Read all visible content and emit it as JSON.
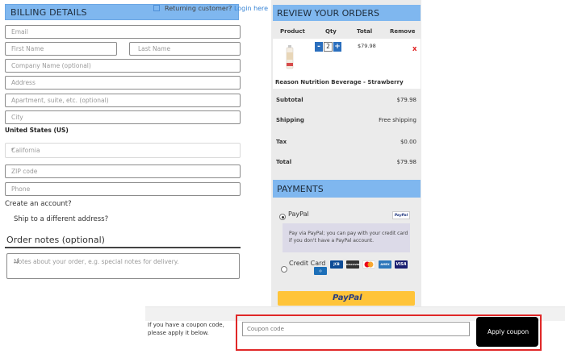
{
  "billing": {
    "header": "BILLING DETAILS",
    "returning_text": "Returning customer?",
    "login_link": "Login here",
    "fields": {
      "email": "Email",
      "first_name": "First Name",
      "last_name": "Last Name",
      "company": "Company Name (optional)",
      "address": "Address",
      "apartment": "Apartment, suite, etc. (optional)",
      "city": "City",
      "country": "United States (US)",
      "state": "California",
      "zip": "ZIP code",
      "phone": "Phone"
    },
    "create_account": "Create an account?",
    "ship_different": "Ship to a different address?",
    "order_notes_title": "Order notes (optional)",
    "order_notes_placeholder": "Notes about your order, e.g. special notes for delivery."
  },
  "review": {
    "header": "REVIEW YOUR ORDERS",
    "columns": [
      "Product",
      "Qty",
      "Total",
      "Remove"
    ],
    "item": {
      "name": "Reason Nutrition Beverage - Strawberry",
      "qty": "2",
      "total": "$79.98",
      "remove": "x",
      "minus": "-",
      "plus": "+"
    },
    "summary": {
      "subtotal_label": "Subtotal",
      "subtotal_value": "$79.98",
      "shipping_label": "Shipping",
      "shipping_value": "Free shipping",
      "tax_label": "Tax",
      "tax_value": "$0.00",
      "total_label": "Total",
      "total_value": "$79.98"
    }
  },
  "payments": {
    "header": "PAYMENTS",
    "paypal_label": "PayPal",
    "paypal_badge": "PayPal",
    "paypal_desc": "Pay via PayPal; you can pay with your credit card if you don't have a PayPal account.",
    "credit_label": "Credit Card",
    "cards": [
      "JCB",
      "DISCOVER",
      "MC",
      "AMEX",
      "VISA"
    ],
    "paypal_button": "PayPal"
  },
  "coupon": {
    "text": "If you have a coupon code, please apply it below.",
    "placeholder": "Coupon code",
    "apply": "Apply coupon"
  },
  "colors": {
    "section_header": "#7fb7ef",
    "remove_red": "#e02020",
    "paypal_yellow": "#ffc439",
    "coupon_highlight": "#e02828"
  }
}
